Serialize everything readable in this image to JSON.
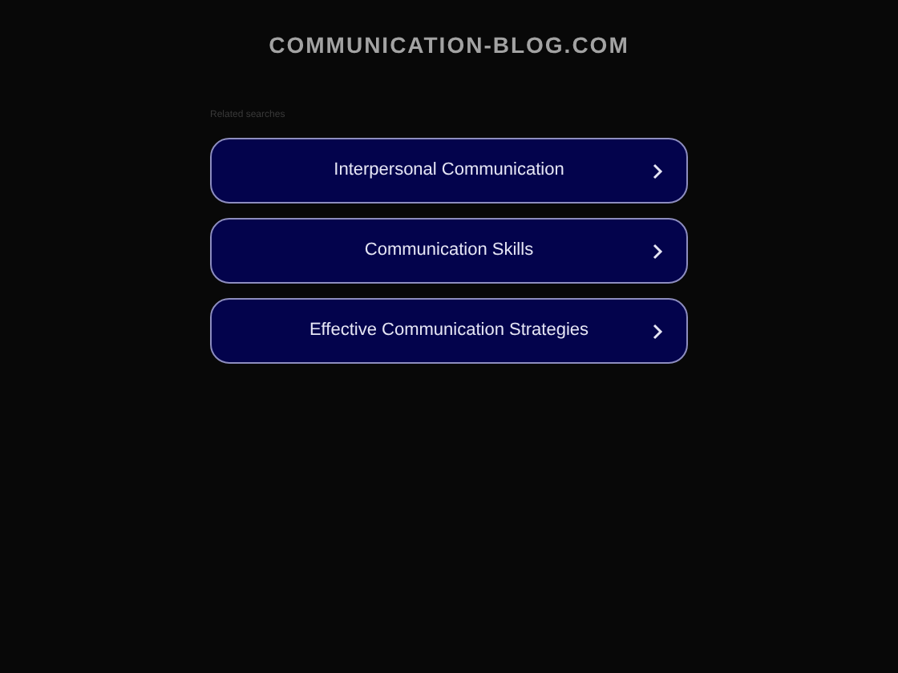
{
  "domain": "COMMUNICATION-BLOG.COM",
  "section_label": "Related searches",
  "links": [
    {
      "label": "Interpersonal Communication"
    },
    {
      "label": "Communication Skills"
    },
    {
      "label": "Effective Communication Strategies"
    }
  ]
}
